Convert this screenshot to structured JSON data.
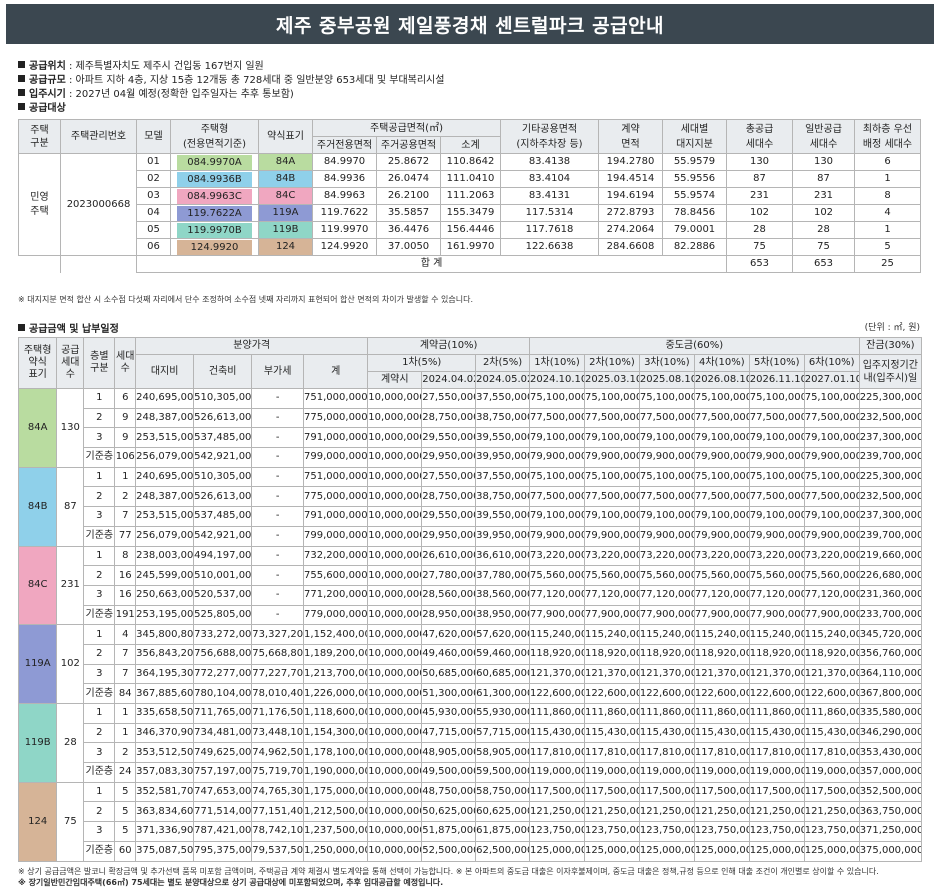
{
  "title": "제주 중부공원 제일풍경채 센트럴파크 공급안내",
  "info": [
    {
      "label": "공급위치",
      "value": " : 제주특별자치도 제주시 건입동 167번지 일원"
    },
    {
      "label": "공급규모",
      "value": " : 아파트 지하 4층, 지상 15층 12개동 총 728세대 중 일반분양 653세대 및 부대복리시설"
    },
    {
      "label": "입주시기",
      "value": " : 2027년 04월 예정(정확한 입주일자는 추후 통보함)"
    },
    {
      "label": "공급대상",
      "value": ""
    }
  ],
  "supply": {
    "headers": {
      "type": "주택\n구분",
      "mgmt": "주택관리번호",
      "model": "모델",
      "housing_type": "주택형",
      "housing_type_sub": "(전용면적기준)",
      "short": "약식표기",
      "area_group": "주택공급면적(㎡)",
      "exclusive": "주거전용면적",
      "common": "주거공용면적",
      "subtotal": "소계",
      "other": "기타공용면적",
      "other_sub": "(지하주차장 등)",
      "contract": "계약",
      "contract_sub": "면적",
      "land": "세대별",
      "land_sub": "대지지분",
      "total": "총공급",
      "total_sub": "세대수",
      "general": "일반공급",
      "general_sub": "세대수",
      "priority": "최하층 우선",
      "priority_sub": "배정 세대수"
    },
    "type_label": "민영\n주택",
    "mgmt_no": "2023000668",
    "rows": [
      {
        "model": "01",
        "type": "084.9970A",
        "short": "84A",
        "exclusive": "84.9970",
        "common": "25.8672",
        "subtotal": "110.8642",
        "other": "83.4138",
        "contract": "194.2780",
        "land": "55.9579",
        "total": "130",
        "general": "130",
        "priority": "6"
      },
      {
        "model": "02",
        "type": "084.9936B",
        "short": "84B",
        "exclusive": "84.9936",
        "common": "26.0474",
        "subtotal": "111.0410",
        "other": "83.4104",
        "contract": "194.4514",
        "land": "55.9556",
        "total": "87",
        "general": "87",
        "priority": "1"
      },
      {
        "model": "03",
        "type": "084.9963C",
        "short": "84C",
        "exclusive": "84.9963",
        "common": "26.2100",
        "subtotal": "111.2063",
        "other": "83.4131",
        "contract": "194.6194",
        "land": "55.9574",
        "total": "231",
        "general": "231",
        "priority": "8"
      },
      {
        "model": "04",
        "type": "119.7622A",
        "short": "119A",
        "exclusive": "119.7622",
        "common": "35.5857",
        "subtotal": "155.3479",
        "other": "117.5314",
        "contract": "272.8793",
        "land": "78.8456",
        "total": "102",
        "general": "102",
        "priority": "4"
      },
      {
        "model": "05",
        "type": "119.9970B",
        "short": "119B",
        "exclusive": "119.9970",
        "common": "36.4476",
        "subtotal": "156.4446",
        "other": "117.7618",
        "contract": "274.2064",
        "land": "79.0001",
        "total": "28",
        "general": "28",
        "priority": "1"
      },
      {
        "model": "06",
        "type": "124.9920",
        "short": "124",
        "exclusive": "124.9920",
        "common": "37.0050",
        "subtotal": "161.9970",
        "other": "122.6638",
        "contract": "284.6608",
        "land": "82.2886",
        "total": "75",
        "general": "75",
        "priority": "5"
      }
    ],
    "sum_label": "합 계",
    "sum_total": "653",
    "sum_general": "653",
    "sum_priority": "25",
    "note": "※ 대지지분 면적 합산 시 소수점 다섯째 자리에서 단수 조정하여 소수점 넷째 자리까지 표현되어 합산 면적의 차이가 발생할 수 있습니다."
  },
  "price": {
    "section": "공급금액 및 납부일정",
    "unit": "(단위 : ㎡, 원)",
    "headers": {
      "type": "주택형\n약식\n표기",
      "households": "공급\n세대수",
      "floor": "층별\n구분",
      "units": "세대\n수",
      "price_group": "분양가격",
      "land": "대지비",
      "building": "건축비",
      "vat": "부가세",
      "sum": "계",
      "deposit_group": "계약금(10%)",
      "first": "1차(5%)",
      "second": "2차(5%)",
      "on_contract": "계약시",
      "d1": "2024.04.02",
      "d2": "2024.05.02",
      "mid_group": "중도금(60%)",
      "m1": "1차(10%)",
      "m2": "2차(10%)",
      "m3": "3차(10%)",
      "m4": "4차(10%)",
      "m5": "5차(10%)",
      "m6": "6차(10%)",
      "md1": "2024.10.10",
      "md2": "2025.03.10",
      "md3": "2025.08.10",
      "md4": "2026.08.10",
      "md5": "2026.11.10",
      "md6": "2027.01.10",
      "balance_group": "잔금(30%)",
      "balance": "입주지정기간\n내(입주시)일"
    },
    "groups": [
      {
        "short": "84A",
        "households": "130",
        "cls": "c84A",
        "rows": [
          [
            "1",
            "6",
            "240,695,000",
            "510,305,000",
            "-",
            "751,000,000",
            "10,000,000",
            "27,550,000",
            "37,550,000",
            "75,100,000",
            "75,100,000",
            "75,100,000",
            "75,100,000",
            "75,100,000",
            "75,100,000",
            "225,300,000"
          ],
          [
            "2",
            "9",
            "248,387,000",
            "526,613,000",
            "-",
            "775,000,000",
            "10,000,000",
            "28,750,000",
            "38,750,000",
            "77,500,000",
            "77,500,000",
            "77,500,000",
            "77,500,000",
            "77,500,000",
            "77,500,000",
            "232,500,000"
          ],
          [
            "3",
            "9",
            "253,515,000",
            "537,485,000",
            "-",
            "791,000,000",
            "10,000,000",
            "29,550,000",
            "39,550,000",
            "79,100,000",
            "79,100,000",
            "79,100,000",
            "79,100,000",
            "79,100,000",
            "79,100,000",
            "237,300,000"
          ],
          [
            "기준층",
            "106",
            "256,079,000",
            "542,921,000",
            "-",
            "799,000,000",
            "10,000,000",
            "29,950,000",
            "39,950,000",
            "79,900,000",
            "79,900,000",
            "79,900,000",
            "79,900,000",
            "79,900,000",
            "79,900,000",
            "239,700,000"
          ]
        ]
      },
      {
        "short": "84B",
        "households": "87",
        "cls": "c84B",
        "rows": [
          [
            "1",
            "1",
            "240,695,000",
            "510,305,000",
            "-",
            "751,000,000",
            "10,000,000",
            "27,550,000",
            "37,550,000",
            "75,100,000",
            "75,100,000",
            "75,100,000",
            "75,100,000",
            "75,100,000",
            "75,100,000",
            "225,300,000"
          ],
          [
            "2",
            "2",
            "248,387,000",
            "526,613,000",
            "-",
            "775,000,000",
            "10,000,000",
            "28,750,000",
            "38,750,000",
            "77,500,000",
            "77,500,000",
            "77,500,000",
            "77,500,000",
            "77,500,000",
            "77,500,000",
            "232,500,000"
          ],
          [
            "3",
            "7",
            "253,515,000",
            "537,485,000",
            "-",
            "791,000,000",
            "10,000,000",
            "29,550,000",
            "39,550,000",
            "79,100,000",
            "79,100,000",
            "79,100,000",
            "79,100,000",
            "79,100,000",
            "79,100,000",
            "237,300,000"
          ],
          [
            "기준층",
            "77",
            "256,079,000",
            "542,921,000",
            "-",
            "799,000,000",
            "10,000,000",
            "29,950,000",
            "39,950,000",
            "79,900,000",
            "79,900,000",
            "79,900,000",
            "79,900,000",
            "79,900,000",
            "79,900,000",
            "239,700,000"
          ]
        ]
      },
      {
        "short": "84C",
        "households": "231",
        "cls": "c84C",
        "rows": [
          [
            "1",
            "8",
            "238,003,000",
            "494,197,000",
            "-",
            "732,200,000",
            "10,000,000",
            "26,610,000",
            "36,610,000",
            "73,220,000",
            "73,220,000",
            "73,220,000",
            "73,220,000",
            "73,220,000",
            "73,220,000",
            "219,660,000"
          ],
          [
            "2",
            "16",
            "245,599,000",
            "510,001,000",
            "-",
            "755,600,000",
            "10,000,000",
            "27,780,000",
            "37,780,000",
            "75,560,000",
            "75,560,000",
            "75,560,000",
            "75,560,000",
            "75,560,000",
            "75,560,000",
            "226,680,000"
          ],
          [
            "3",
            "16",
            "250,663,000",
            "520,537,000",
            "-",
            "771,200,000",
            "10,000,000",
            "28,560,000",
            "38,560,000",
            "77,120,000",
            "77,120,000",
            "77,120,000",
            "77,120,000",
            "77,120,000",
            "77,120,000",
            "231,360,000"
          ],
          [
            "기준층",
            "191",
            "253,195,000",
            "525,805,000",
            "-",
            "779,000,000",
            "10,000,000",
            "28,950,000",
            "38,950,000",
            "77,900,000",
            "77,900,000",
            "77,900,000",
            "77,900,000",
            "77,900,000",
            "77,900,000",
            "233,700,000"
          ]
        ]
      },
      {
        "short": "119A",
        "households": "102",
        "cls": "c119A",
        "rows": [
          [
            "1",
            "4",
            "345,800,800",
            "733,272,000",
            "73,327,200",
            "1,152,400,000",
            "10,000,000",
            "47,620,000",
            "57,620,000",
            "115,240,000",
            "115,240,000",
            "115,240,000",
            "115,240,000",
            "115,240,000",
            "115,240,000",
            "345,720,000"
          ],
          [
            "2",
            "7",
            "356,843,200",
            "756,688,000",
            "75,668,800",
            "1,189,200,000",
            "10,000,000",
            "49,460,000",
            "59,460,000",
            "118,920,000",
            "118,920,000",
            "118,920,000",
            "118,920,000",
            "118,920,000",
            "118,920,000",
            "356,760,000"
          ],
          [
            "3",
            "7",
            "364,195,300",
            "772,277,000",
            "77,227,700",
            "1,213,700,000",
            "10,000,000",
            "50,685,000",
            "60,685,000",
            "121,370,000",
            "121,370,000",
            "121,370,000",
            "121,370,000",
            "121,370,000",
            "121,370,000",
            "364,110,000"
          ],
          [
            "기준층",
            "84",
            "367,885,600",
            "780,104,000",
            "78,010,400",
            "1,226,000,000",
            "10,000,000",
            "51,300,000",
            "61,300,000",
            "122,600,000",
            "122,600,000",
            "122,600,000",
            "122,600,000",
            "122,600,000",
            "122,600,000",
            "367,800,000"
          ]
        ]
      },
      {
        "short": "119B",
        "households": "28",
        "cls": "c119B",
        "rows": [
          [
            "1",
            "1",
            "335,658,500",
            "711,765,000",
            "71,176,500",
            "1,118,600,000",
            "10,000,000",
            "45,930,000",
            "55,930,000",
            "111,860,000",
            "111,860,000",
            "111,860,000",
            "111,860,000",
            "111,860,000",
            "111,860,000",
            "335,580,000"
          ],
          [
            "2",
            "1",
            "346,370,900",
            "734,481,000",
            "73,448,100",
            "1,154,300,000",
            "10,000,000",
            "47,715,000",
            "57,715,000",
            "115,430,000",
            "115,430,000",
            "115,430,000",
            "115,430,000",
            "115,430,000",
            "115,430,000",
            "346,290,000"
          ],
          [
            "3",
            "2",
            "353,512,500",
            "749,625,000",
            "74,962,500",
            "1,178,100,000",
            "10,000,000",
            "48,905,000",
            "58,905,000",
            "117,810,000",
            "117,810,000",
            "117,810,000",
            "117,810,000",
            "117,810,000",
            "117,810,000",
            "353,430,000"
          ],
          [
            "기준층",
            "24",
            "357,083,300",
            "757,197,000",
            "75,719,700",
            "1,190,000,000",
            "10,000,000",
            "49,500,000",
            "59,500,000",
            "119,000,000",
            "119,000,000",
            "119,000,000",
            "119,000,000",
            "119,000,000",
            "119,000,000",
            "357,000,000"
          ]
        ]
      },
      {
        "short": "124",
        "households": "75",
        "cls": "c124",
        "rows": [
          [
            "1",
            "5",
            "352,581,700",
            "747,653,000",
            "74,765,300",
            "1,175,000,000",
            "10,000,000",
            "48,750,000",
            "58,750,000",
            "117,500,000",
            "117,500,000",
            "117,500,000",
            "117,500,000",
            "117,500,000",
            "117,500,000",
            "352,500,000"
          ],
          [
            "2",
            "5",
            "363,834,600",
            "771,514,000",
            "77,151,400",
            "1,212,500,000",
            "10,000,000",
            "50,625,000",
            "60,625,000",
            "121,250,000",
            "121,250,000",
            "121,250,000",
            "121,250,000",
            "121,250,000",
            "121,250,000",
            "363,750,000"
          ],
          [
            "3",
            "5",
            "371,336,900",
            "787,421,000",
            "78,742,100",
            "1,237,500,000",
            "10,000,000",
            "51,875,000",
            "61,875,000",
            "123,750,000",
            "123,750,000",
            "123,750,000",
            "123,750,000",
            "123,750,000",
            "123,750,000",
            "371,250,000"
          ],
          [
            "기준층",
            "60",
            "375,087,500",
            "795,375,000",
            "79,537,500",
            "1,250,000,000",
            "10,000,000",
            "52,500,000",
            "62,500,000",
            "125,000,000",
            "125,000,000",
            "125,000,000",
            "125,000,000",
            "125,000,000",
            "125,000,000",
            "375,000,000"
          ]
        ]
      }
    ],
    "note1": "※ 상기 공급금액은 발코니 확장금액 및 추가선택 품목 미포함 금액이며, 주택공급 계약 체결시 별도계약을 통해 선택이 가능합니다.  ※ 본 아파트의 중도금 대출은 이자후불제이며, 중도금 대출은 정책,규정 등으로 인해 대출 조건이 개인별로 상이할 수 있습니다.",
    "note2": "※ 장기일반민간임대주택(66㎡) 75세대는 별도 분양대상으로 상기 공급대상에 미포함되었으며, 추후 임대공급할 예정입니다."
  }
}
